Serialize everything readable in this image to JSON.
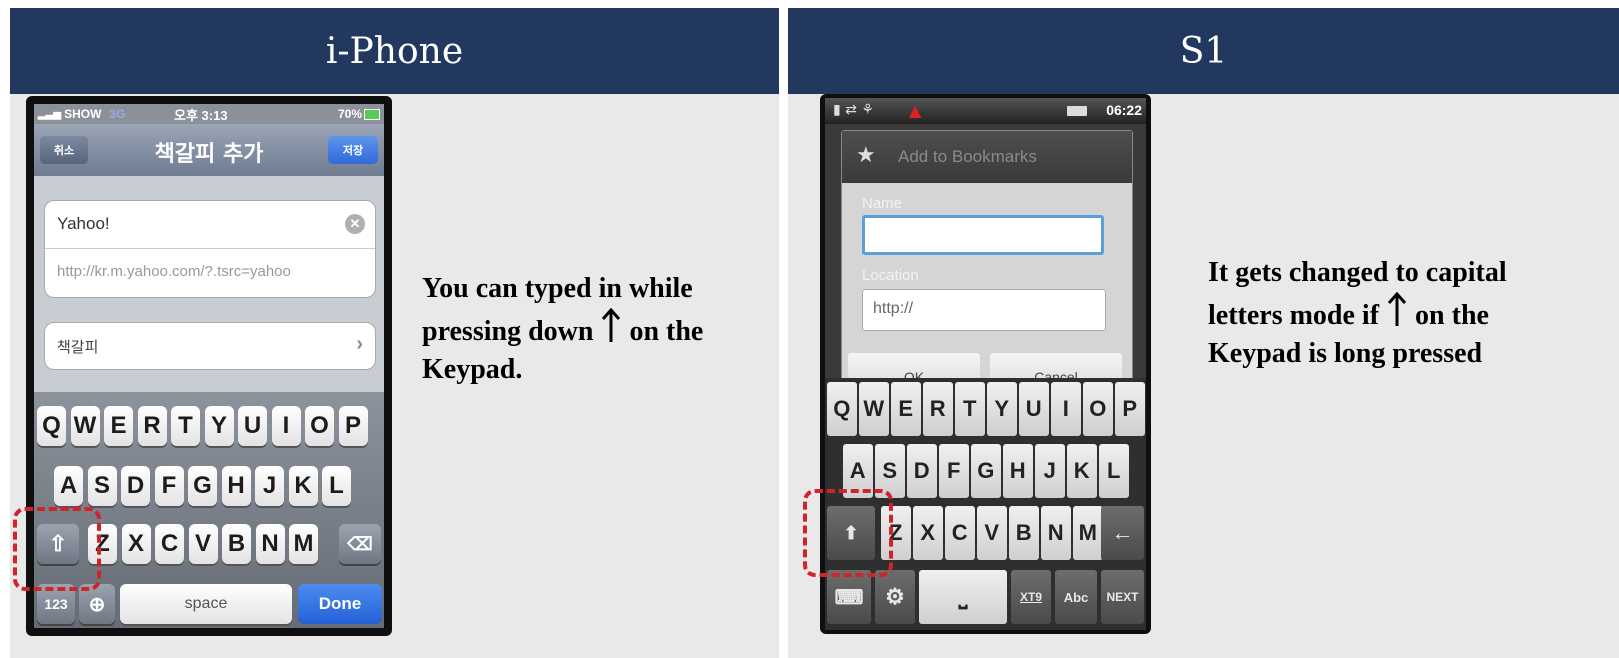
{
  "left": {
    "title": "i-Phone",
    "description": [
      "You can typed in while",
      "pressing down",
      "on the",
      "Keypad."
    ],
    "status": {
      "carrier": "SHOW",
      "network": "3G",
      "time": "오후 3:13",
      "battery": "70%"
    },
    "nav": {
      "cancel": "취소",
      "title": "책갈피 추가",
      "save": "저장"
    },
    "fields": {
      "name": "Yahoo!",
      "url": "http://kr.m.yahoo.com/?.tsrc=yahoo",
      "folder": "책갈피"
    },
    "keyboard": {
      "row1": [
        "Q",
        "W",
        "E",
        "R",
        "T",
        "Y",
        "U",
        "I",
        "O",
        "P"
      ],
      "row2": [
        "A",
        "S",
        "D",
        "F",
        "G",
        "H",
        "J",
        "K",
        "L"
      ],
      "row3": [
        "Z",
        "X",
        "C",
        "V",
        "B",
        "N",
        "M"
      ],
      "num": "123",
      "space": "space",
      "done": "Done"
    }
  },
  "right": {
    "title": "S1",
    "description": [
      "It gets changed to capital",
      "letters mode if",
      "on the",
      "Keypad is long pressed"
    ],
    "status": {
      "time": "06:22"
    },
    "dialog": {
      "title": "Add to Bookmarks",
      "name_label": "Name",
      "name_value": "",
      "location_label": "Location",
      "location_value": "http://",
      "ok": "OK",
      "cancel": "Cancel"
    },
    "keyboard": {
      "row1": [
        "Q",
        "W",
        "E",
        "R",
        "T",
        "Y",
        "U",
        "I",
        "O",
        "P"
      ],
      "row2": [
        "A",
        "S",
        "D",
        "F",
        "G",
        "H",
        "J",
        "K",
        "L"
      ],
      "row3": [
        "Z",
        "X",
        "C",
        "V",
        "B",
        "N",
        "M"
      ],
      "xt9": "XT9",
      "abc": "Abc",
      "next": "NEXT"
    }
  },
  "colors": {
    "header": "#22385f",
    "panel": "#e9e9ea",
    "highlight": "#d0232a"
  }
}
